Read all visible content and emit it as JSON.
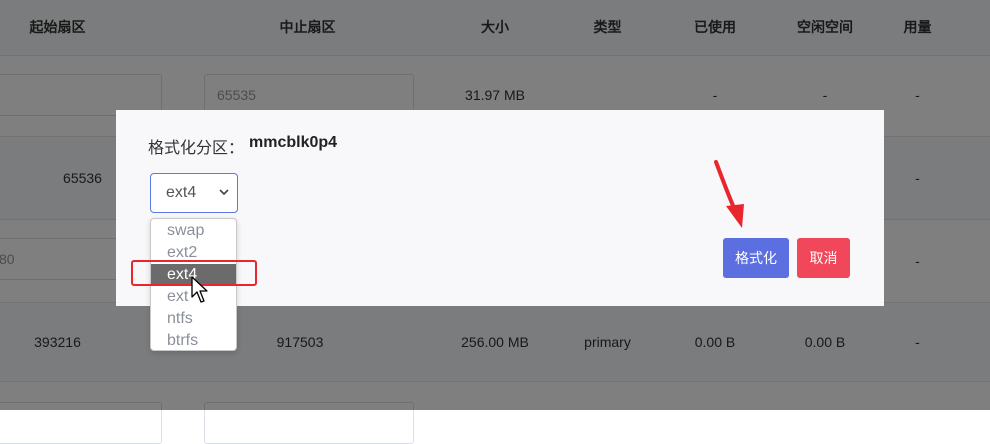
{
  "table": {
    "headers": [
      "起始扇区",
      "中止扇区",
      "大小",
      "类型",
      "已使用",
      "空闲空间",
      "用量"
    ],
    "rows": [
      {
        "start": "",
        "end": "65535",
        "size": "31.97 MB",
        "type": "",
        "used": "-",
        "free": "-",
        "usage": "-"
      },
      {
        "start": "65536",
        "end": "",
        "size": "",
        "type": "",
        "used": "",
        "free": "",
        "usage": "-"
      },
      {
        "start": "80",
        "end": "",
        "size": "",
        "type": "",
        "used": "",
        "free": "",
        "usage": "-"
      },
      {
        "start": "393216",
        "end": "917503",
        "size": "256.00 MB",
        "type": "primary",
        "used": "0.00 B",
        "free": "0.00 B",
        "usage": "-"
      }
    ]
  },
  "dialog": {
    "label": "格式化分区：",
    "partition": "mmcblk0p4",
    "selected_fs": "ext4",
    "fs_options": [
      "swap",
      "ext2",
      "ext4",
      "ext3",
      "ntfs",
      "btrfs"
    ],
    "options_display": [
      "swap",
      "ext2",
      "ext4",
      "ext",
      "ntfs",
      "btrfs"
    ],
    "format_button": "格式化",
    "cancel_button": "取消"
  },
  "colors": {
    "primary": "#5b6fe0",
    "danger": "#f0485a",
    "highlight": "#e8262e"
  }
}
